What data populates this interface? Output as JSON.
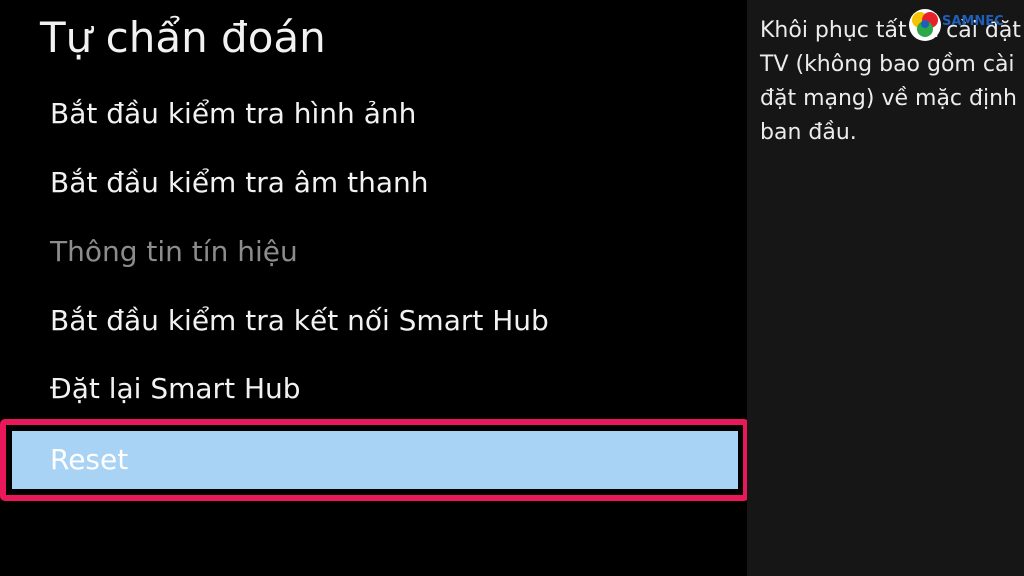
{
  "title": "Tự chẩn đoán",
  "menu": {
    "items": [
      {
        "label": "Bắt đầu kiểm tra hình ảnh",
        "enabled": true
      },
      {
        "label": "Bắt đầu kiểm tra âm thanh",
        "enabled": true
      },
      {
        "label": "Thông tin tín hiệu",
        "enabled": false
      },
      {
        "label": "Bắt đầu kiểm tra kết nối Smart Hub",
        "enabled": true
      },
      {
        "label": "Đặt lại Smart Hub",
        "enabled": true
      }
    ],
    "selected": {
      "label": "Reset"
    }
  },
  "help": {
    "text": "Khôi phục tất cả cài đặt TV (không bao gồm cài đặt mạng) về mặc định ban đầu."
  },
  "logo": {
    "text": "SAMNEC"
  },
  "colors": {
    "background": "#000000",
    "help_panel": "#161616",
    "selected_fill": "#a9d3f5",
    "highlight_border": "#e8185a",
    "disabled_text": "#8c8c8c"
  }
}
